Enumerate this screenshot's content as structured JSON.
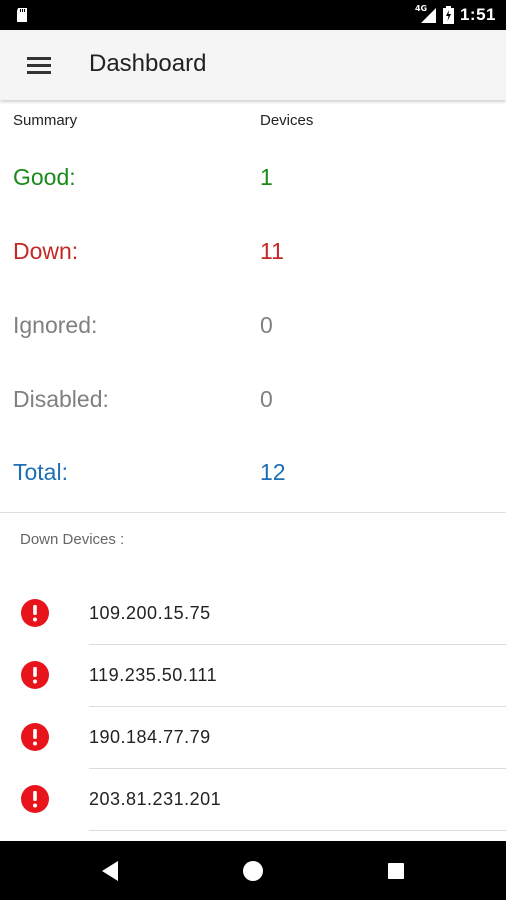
{
  "status_bar": {
    "network": "4G",
    "time": "1:51"
  },
  "app_bar": {
    "title": "Dashboard",
    "menu_icon": "hamburger-menu-icon"
  },
  "summary": {
    "header_label": "Summary",
    "header_value": "Devices",
    "rows": [
      {
        "label": "Good:",
        "value": "1",
        "color": "#1a8a1a"
      },
      {
        "label": "Down:",
        "value": "11",
        "color": "#c62828"
      },
      {
        "label": "Ignored:",
        "value": "0",
        "color": "#808080"
      },
      {
        "label": "Disabled:",
        "value": "0",
        "color": "#808080"
      },
      {
        "label": "Total:",
        "value": "12",
        "color": "#1e6fb5"
      }
    ]
  },
  "down_devices": {
    "title": "Down Devices :",
    "icon": "alert-icon",
    "alert_color": "#e8141c",
    "items": [
      {
        "ip": "109.200.15.75"
      },
      {
        "ip": "119.235.50.111"
      },
      {
        "ip": "190.184.77.79"
      },
      {
        "ip": "203.81.231.201"
      }
    ]
  },
  "nav_bar": {
    "back_icon": "back-icon",
    "home_icon": "home-icon",
    "recents_icon": "recents-icon"
  }
}
